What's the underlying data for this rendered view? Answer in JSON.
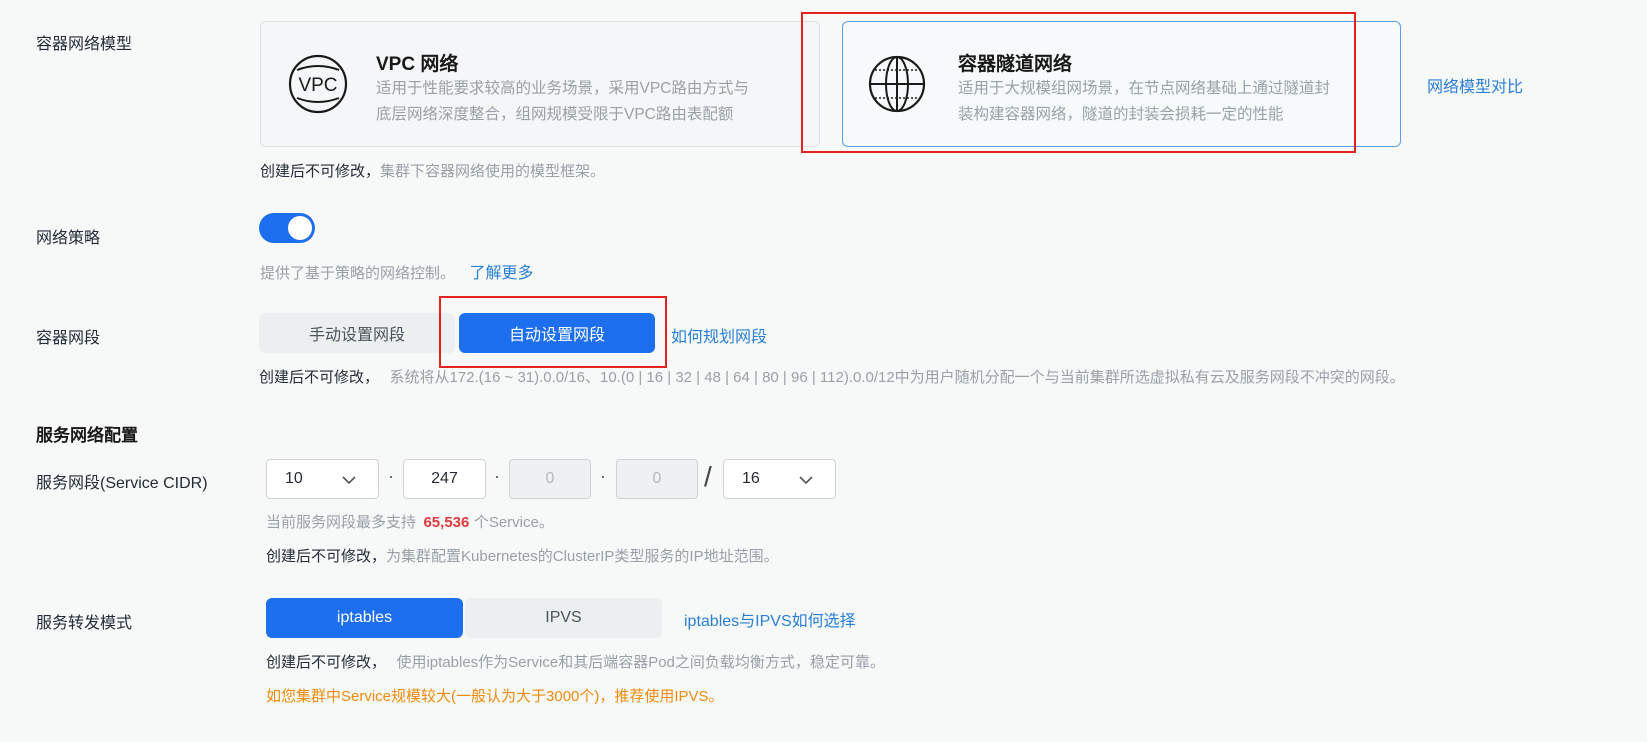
{
  "network_model": {
    "label": "容器网络模型",
    "options": [
      {
        "title": "VPC 网络",
        "icon": "vpc-icon",
        "desc_line1": "适用于性能要求较高的业务场景，采用VPC路由方式与",
        "desc_line2": "底层网络深度整合，组网规模受限于VPC路由表配额",
        "selected": false
      },
      {
        "title": "容器隧道网络",
        "icon": "globe-icon",
        "desc_line1": "适用于大规模组网场景，在节点网络基础上通过隧道封",
        "desc_line2": "装构建容器网络，隧道的封装会损耗一定的性能",
        "selected": true
      }
    ],
    "compare_link": "网络模型对比",
    "note_strong": "创建后不可修改，",
    "note_rest": "集群下容器网络使用的模型框架。"
  },
  "network_policy": {
    "label": "网络策略",
    "enabled": true,
    "note": "提供了基于策略的网络控制。",
    "learn_more": "了解更多"
  },
  "container_cidr": {
    "label": "容器网段",
    "manual": "手动设置网段",
    "auto": "自动设置网段",
    "selected": "auto",
    "plan_link": "如何规划网段",
    "note_strong": "创建后不可修改，",
    "note_rest": "系统将从172.(16 ~ 31).0.0/16、10.(0 | 16 | 32 | 48 | 64 | 80 | 96 | 112).0.0/12中为用户随机分配一个与当前集群所选虚拟私有云及服务网段不冲突的网段。"
  },
  "service_network": {
    "section_title": "服务网络配置",
    "cidr_label": "服务网段(Service CIDR)",
    "octet1": "10",
    "octet2": "247",
    "octet3": "0",
    "octet4": "0",
    "mask": "16",
    "dot": "·",
    "slash": "/",
    "capacity_prefix": "当前服务网段最多支持",
    "capacity_value": "65,536",
    "capacity_suffix": "个Service。",
    "capacity_color": "#e0393e",
    "note_strong": "创建后不可修改，",
    "note_rest": "为集群配置Kubernetes的ClusterIP类型服务的IP地址范围。"
  },
  "forward_mode": {
    "label": "服务转发模式",
    "iptables": "iptables",
    "ipvs": "IPVS",
    "selected": "iptables",
    "choose_link": "iptables与IPVS如何选择",
    "note_strong": "创建后不可修改，",
    "note_rest": "使用iptables作为Service和其后端容器Pod之间负载均衡方式，稳定可靠。",
    "warning": "如您集群中Service规模较大(一般认为大于3000个)，推荐使用IPVS。",
    "warning_color": "#ef8a0c"
  },
  "colors": {
    "accent": "#1e6ff0",
    "link": "#2a7fd9",
    "highlight_box": "#e3211f"
  }
}
